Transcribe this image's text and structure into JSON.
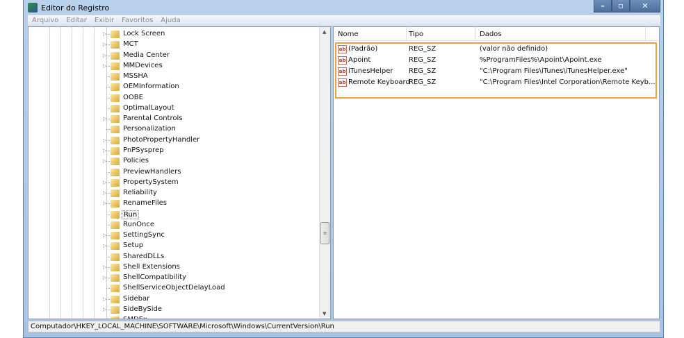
{
  "window": {
    "title": "Editor do Registro",
    "minimize": "–",
    "maximize": "▫",
    "close": "✕"
  },
  "menu": [
    "Arquivo",
    "Editar",
    "Exibir",
    "Favoritos",
    "Ajuda"
  ],
  "tree": {
    "selected": "Run",
    "items": [
      {
        "label": "Lock Screen",
        "expandable": true
      },
      {
        "label": "MCT",
        "expandable": true
      },
      {
        "label": "Media Center",
        "expandable": true
      },
      {
        "label": "MMDevices",
        "expandable": true
      },
      {
        "label": "MSSHA",
        "expandable": false
      },
      {
        "label": "OEMInformation",
        "expandable": false
      },
      {
        "label": "OOBE",
        "expandable": false
      },
      {
        "label": "OptimalLayout",
        "expandable": false
      },
      {
        "label": "Parental Controls",
        "expandable": true
      },
      {
        "label": "Personalization",
        "expandable": false
      },
      {
        "label": "PhotoPropertyHandler",
        "expandable": true
      },
      {
        "label": "PnPSysprep",
        "expandable": true
      },
      {
        "label": "Policies",
        "expandable": true
      },
      {
        "label": "PreviewHandlers",
        "expandable": false
      },
      {
        "label": "PropertySystem",
        "expandable": true
      },
      {
        "label": "Reliability",
        "expandable": true
      },
      {
        "label": "RenameFiles",
        "expandable": true
      },
      {
        "label": "Run",
        "expandable": false
      },
      {
        "label": "RunOnce",
        "expandable": false
      },
      {
        "label": "SettingSync",
        "expandable": true
      },
      {
        "label": "Setup",
        "expandable": true
      },
      {
        "label": "SharedDLLs",
        "expandable": false
      },
      {
        "label": "Shell Extensions",
        "expandable": true
      },
      {
        "label": "ShellCompatibility",
        "expandable": true
      },
      {
        "label": "ShellServiceObjectDelayLoad",
        "expandable": false
      },
      {
        "label": "Sidebar",
        "expandable": true
      },
      {
        "label": "SideBySide",
        "expandable": true
      },
      {
        "label": "SMDEx",
        "expandable": false
      }
    ]
  },
  "list": {
    "columns": [
      "Nome",
      "Tipo",
      "Dados"
    ],
    "rows": [
      {
        "name": "(Padrão)",
        "type": "REG_SZ",
        "data": "(valor não definido)"
      },
      {
        "name": "Apoint",
        "type": "REG_SZ",
        "data": "%ProgramFiles%\\Apoint\\Apoint.exe"
      },
      {
        "name": "iTunesHelper",
        "type": "REG_SZ",
        "data": "\"C:\\Program Files\\iTunes\\iTunesHelper.exe\""
      },
      {
        "name": "Remote Keyboard",
        "type": "REG_SZ",
        "data": "\"C:\\Program Files\\Intel Corporation\\Remote Keyb..."
      }
    ],
    "value_icon": "ab",
    "highlight_color": "#f0a040"
  },
  "status": "Computador\\HKEY_LOCAL_MACHINE\\SOFTWARE\\Microsoft\\Windows\\CurrentVersion\\Run"
}
